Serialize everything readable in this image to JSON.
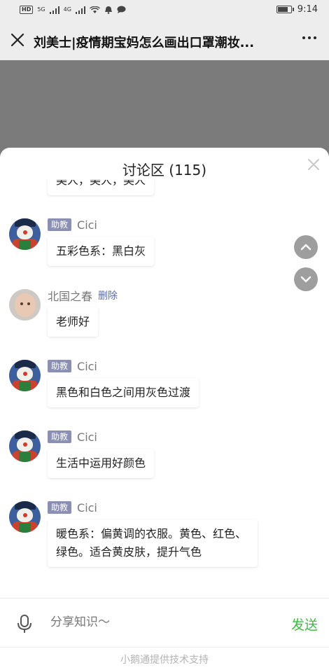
{
  "status_bar": {
    "chip": "HD",
    "net_left": "5G",
    "net_right": "4G",
    "time": "9:14",
    "battery_level": 0.7
  },
  "nav": {
    "title": "刘美士|疫情期宝妈怎么画出口罩潮妆...",
    "close_icon": "close-icon",
    "more_icon": "more-icon"
  },
  "discussion": {
    "title": "讨论区 (115)",
    "messages": [
      {
        "avatar": "pink",
        "role": "",
        "name": "",
        "action": "",
        "text": "美人，美人，美人"
      },
      {
        "avatar": "clown",
        "role": "助教",
        "name": "Cici",
        "action": "",
        "text": "五彩色系：黑白灰"
      },
      {
        "avatar": "baby",
        "role": "",
        "name": "北国之春",
        "action": "删除",
        "text": "老师好"
      },
      {
        "avatar": "clown",
        "role": "助教",
        "name": "Cici",
        "action": "",
        "text": "黑色和白色之间用灰色过渡"
      },
      {
        "avatar": "clown",
        "role": "助教",
        "name": "Cici",
        "action": "",
        "text": "生活中运用好颜色"
      },
      {
        "avatar": "clown",
        "role": "助教",
        "name": "Cici",
        "action": "",
        "text": "暖色系：偏黄调的衣服。黄色、红色、绿色。适合黄皮肤，提升气色"
      }
    ]
  },
  "input": {
    "placeholder": "分享知识〜",
    "send_label": "发送"
  },
  "footer": {
    "text": "小鹅通提供技术支持"
  },
  "colors": {
    "accent_green": "#3dbb3d",
    "badge": "#8a8fb3",
    "link": "#5b6ea8"
  }
}
